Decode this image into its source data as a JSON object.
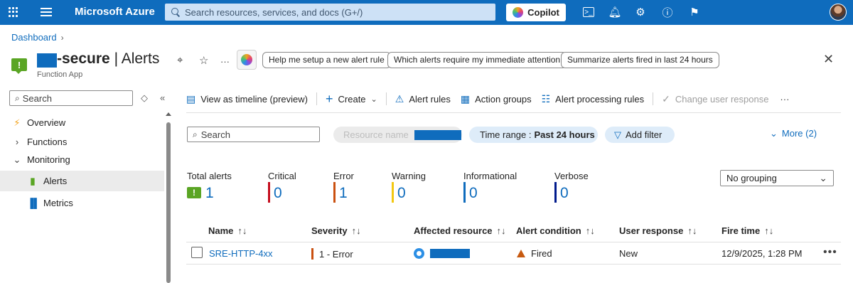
{
  "topbar": {
    "brand": "Microsoft Azure",
    "search_placeholder": "Search resources, services, and docs (G+/)",
    "copilot_label": "Copilot"
  },
  "breadcrumb": {
    "items": [
      "Dashboard"
    ]
  },
  "header": {
    "title_resource": "-secure",
    "title_section": "| Alerts",
    "subtitle": "Function App",
    "prompts": [
      "Help me setup a new alert rule",
      "Which alerts require my immediate attention",
      "Summarize alerts fired in last 24 hours"
    ]
  },
  "sidebar": {
    "search_placeholder": "Search",
    "items": [
      {
        "label": "Overview",
        "icon": "function-app-icon"
      },
      {
        "label": "Functions",
        "icon": "chevron-right-icon"
      },
      {
        "label": "Monitoring",
        "icon": "chevron-down-icon"
      },
      {
        "label": "Alerts",
        "icon": "alerts-icon",
        "active": true
      },
      {
        "label": "Metrics",
        "icon": "metrics-icon"
      }
    ]
  },
  "toolbar": {
    "timeline": "View as timeline (preview)",
    "create": "Create",
    "alert_rules": "Alert rules",
    "action_groups": "Action groups",
    "processing_rules": "Alert processing rules",
    "change_response": "Change user response"
  },
  "filters": {
    "search_placeholder": "Search",
    "resource_label": "Resource name",
    "time_label": "Time range :",
    "time_value": "Past 24 hours",
    "add_filter": "Add filter",
    "more": "More (2)"
  },
  "summary": [
    {
      "label": "Total alerts",
      "value": "1"
    },
    {
      "label": "Critical",
      "value": "0",
      "color": "#c50f1f"
    },
    {
      "label": "Error",
      "value": "1",
      "color": "#ca5010"
    },
    {
      "label": "Warning",
      "value": "0",
      "color": "#f2c811"
    },
    {
      "label": "Informational",
      "value": "0",
      "color": "#0f6cbd"
    },
    {
      "label": "Verbose",
      "value": "0",
      "color": "#001a8c"
    }
  ],
  "grouping": "No grouping",
  "table": {
    "columns": [
      "Name",
      "Severity",
      "Affected resource",
      "Alert condition",
      "User response",
      "Fire time"
    ],
    "rows": [
      {
        "name": "SRE-HTTP-4xx",
        "severity": "1 - Error",
        "condition": "Fired",
        "user_response": "New",
        "fire_time": "12/9/2025, 1:28 PM"
      }
    ]
  }
}
